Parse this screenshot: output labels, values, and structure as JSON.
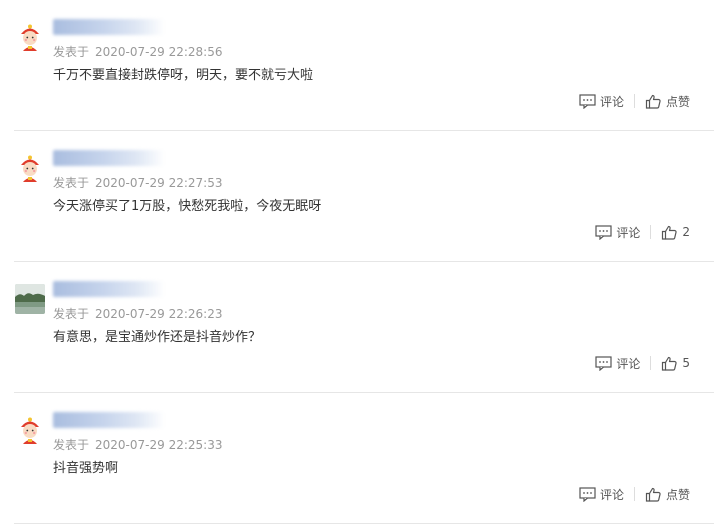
{
  "colors": {
    "meta": "#999999",
    "text": "#333333",
    "divider": "#e6e6e6",
    "name_blur": "#a9bddf"
  },
  "icons": {
    "comment": "comment-icon",
    "like": "thumbs-up-icon"
  },
  "comments": [
    {
      "avatar_type": "cartoon",
      "meta_prefix": "发表于",
      "time": "2020-07-29 22:28:56",
      "content": "千万不要直接封跌停呀，明天，要不就亏大啦",
      "reply_label": "评论",
      "like_label": "点赞"
    },
    {
      "avatar_type": "cartoon",
      "meta_prefix": "发表于",
      "time": "2020-07-29 22:27:53",
      "content": "今天涨停买了1万股，快愁死我啦，今夜无眠呀",
      "reply_label": "评论",
      "like_label": "2"
    },
    {
      "avatar_type": "photo",
      "meta_prefix": "发表于",
      "time": "2020-07-29 22:26:23",
      "content": "有意思，是宝通炒作还是抖音炒作？",
      "reply_label": "评论",
      "like_label": "5"
    },
    {
      "avatar_type": "cartoon",
      "meta_prefix": "发表于",
      "time": "2020-07-29 22:25:33",
      "content": "抖音强势啊",
      "reply_label": "评论",
      "like_label": "点赞"
    }
  ]
}
